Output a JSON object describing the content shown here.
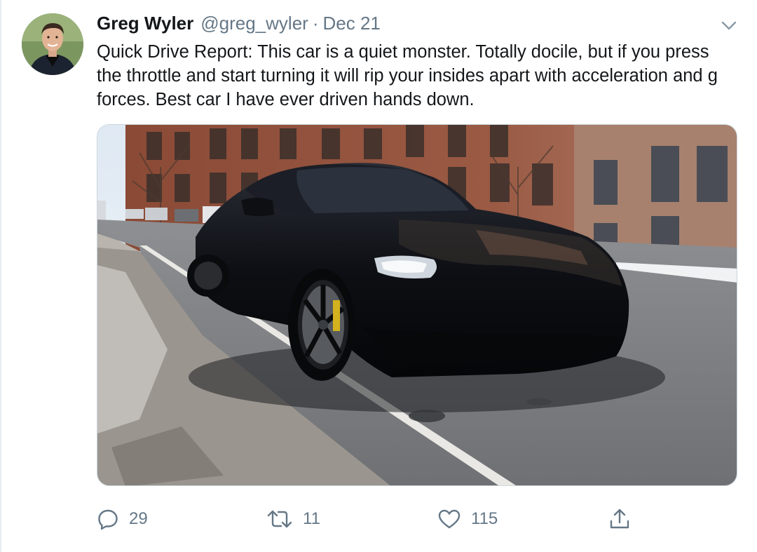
{
  "tweet": {
    "author": {
      "display_name": "Greg Wyler",
      "handle": "@greg_wyler",
      "separator": "·",
      "date": "Dec 21"
    },
    "text": "Quick Drive Report: This car is a quiet monster. Totally docile, but if you press the throttle and start turning it will rip your insides apart with acceleration and g forces. Best car I have ever driven hands down.",
    "media": {
      "description_icon": "photo-of-black-sports-car"
    },
    "actions": {
      "reply_count": "29",
      "retweet_count": "11",
      "like_count": "115"
    },
    "icons": [
      "chevron-down-icon",
      "reply-icon",
      "retweet-icon",
      "like-icon",
      "share-icon"
    ],
    "colors": {
      "secondary_text": "#657786",
      "primary_text": "#14171a",
      "border": "#ccd6dd"
    }
  }
}
